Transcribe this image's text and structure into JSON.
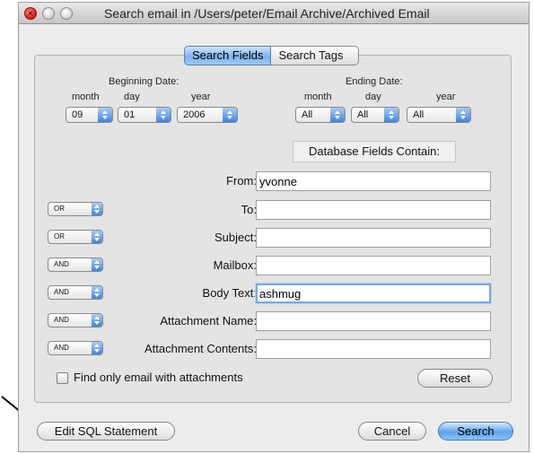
{
  "window": {
    "title": "Search email in /Users/peter/Email Archive/Archived Email"
  },
  "tabs": [
    "Search Fields",
    "Search Tags"
  ],
  "beginning_date": {
    "label": "Beginning Date:",
    "month_label": "month",
    "day_label": "day",
    "year_label": "year",
    "month": "09",
    "day": "01",
    "year": "2006"
  },
  "ending_date": {
    "label": "Ending Date:",
    "month_label": "month",
    "day_label": "day",
    "year_label": "year",
    "month": "All",
    "day": "All",
    "year": "All"
  },
  "db_header": "Database Fields Contain:",
  "fields": [
    {
      "label": "From:",
      "value": "yvonne",
      "operator": ""
    },
    {
      "label": "To:",
      "value": "",
      "operator": "OR"
    },
    {
      "label": "Subject:",
      "value": "",
      "operator": "OR"
    },
    {
      "label": "Mailbox:",
      "value": "",
      "operator": "AND"
    },
    {
      "label": "Body Text:",
      "value": "ashmug",
      "operator": "AND"
    },
    {
      "label": "Attachment Name:",
      "value": "",
      "operator": "AND"
    },
    {
      "label": "Attachment Contents:",
      "value": "",
      "operator": "AND"
    }
  ],
  "attachments_checkbox": {
    "label": "Find only email with attachments",
    "checked": false
  },
  "buttons": {
    "reset": "Reset",
    "edit_sql": "Edit SQL Statement",
    "cancel": "Cancel",
    "search": "Search"
  },
  "colors": {
    "accent": "#5ea3ec",
    "focus": "#7aa8de"
  }
}
